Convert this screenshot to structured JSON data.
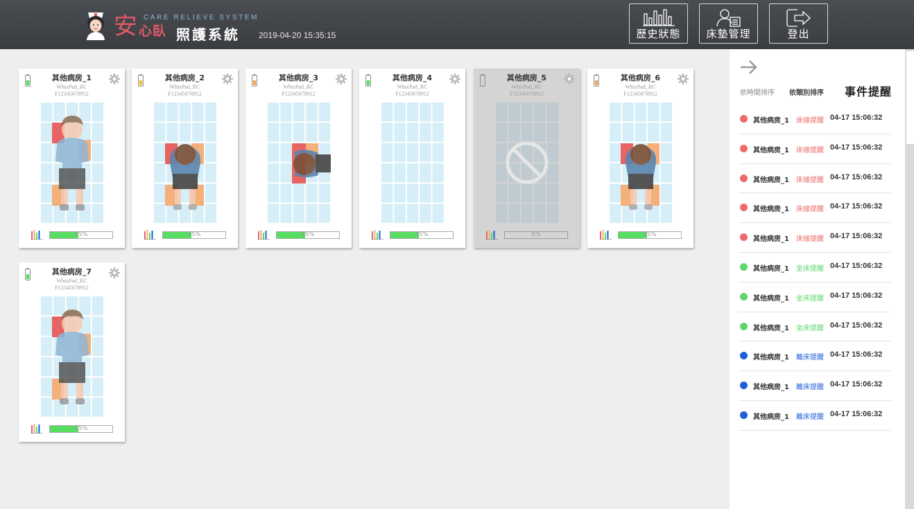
{
  "header": {
    "brand_an": "安",
    "brand_xinwo": "心臥",
    "brand_en": "Care Relieve System",
    "brand_zh": "照護系統",
    "datetime": "2019-04-20 15:35:15",
    "buttons": [
      {
        "label": "歷史狀態",
        "icon": "bar-chart-icon"
      },
      {
        "label": "床墊管理",
        "icon": "user-card-icon"
      },
      {
        "label": "登出",
        "icon": "logout-icon"
      }
    ]
  },
  "cards": [
    {
      "room": "其他病房_1",
      "device": "WhizPad_RC",
      "serial": "F12345678912",
      "progress_label": "45%",
      "progress": 0.45,
      "battery": "green",
      "status": "lying"
    },
    {
      "room": "其他病房_2",
      "device": "WhizPad_RC",
      "serial": "F12345678912",
      "progress_label": "45%",
      "progress": 0.45,
      "battery": "yellow",
      "status": "sitting"
    },
    {
      "room": "其他病房_3",
      "device": "WhizPad_RC",
      "serial": "F12345678912",
      "progress_label": "45%",
      "progress": 0.45,
      "battery": "orange",
      "status": "side-sitting"
    },
    {
      "room": "其他病房_4",
      "device": "WhizPad_RC",
      "serial": "F12345678912",
      "progress_label": "45%",
      "progress": 0.45,
      "battery": "green",
      "status": "empty"
    },
    {
      "room": "其他病房_5",
      "device": "WhizPad_RC",
      "serial": "F12345678912",
      "progress_label": "0%",
      "progress": 0,
      "battery": "empty",
      "status": "offline"
    },
    {
      "room": "其他病房_6",
      "device": "WhizPad_RC",
      "serial": "F12345678912",
      "progress_label": "45%",
      "progress": 0.45,
      "battery": "orange",
      "status": "sitting"
    },
    {
      "room": "其他病房_7",
      "device": "WhizPad_RC",
      "serial": "F12345678912",
      "progress_label": "45%",
      "progress": 0.45,
      "battery": "green",
      "status": "lying"
    }
  ],
  "panel": {
    "sort_time": "依時間排序",
    "sort_type": "依類別排序",
    "title": "事件提醒",
    "events": [
      {
        "room": "其他病房_1",
        "type": "床緣提醒",
        "time": "04-17 15:06:32",
        "color": "#ee6b6b"
      },
      {
        "room": "其他病房_1",
        "type": "床緣提醒",
        "time": "04-17 15:06:32",
        "color": "#ee6b6b"
      },
      {
        "room": "其他病房_1",
        "type": "床緣提醒",
        "time": "04-17 15:06:32",
        "color": "#ee6b6b"
      },
      {
        "room": "其他病房_1",
        "type": "床緣提醒",
        "time": "04-17 15:06:32",
        "color": "#ee6b6b"
      },
      {
        "room": "其他病房_1",
        "type": "床緣提醒",
        "time": "04-17 15:06:32",
        "color": "#ee6b6b"
      },
      {
        "room": "其他病房_1",
        "type": "坐床提醒",
        "time": "04-17 15:06:32",
        "color": "#5fd66d"
      },
      {
        "room": "其他病房_1",
        "type": "坐床提醒",
        "time": "04-17 15:06:32",
        "color": "#5fd66d"
      },
      {
        "room": "其他病房_1",
        "type": "坐床提醒",
        "time": "04-17 15:06:32",
        "color": "#5fd66d"
      },
      {
        "room": "其他病房_1",
        "type": "離床提醒",
        "time": "04-17 15:06:32",
        "color": "#1f5fd8"
      },
      {
        "room": "其他病房_1",
        "type": "離床提醒",
        "time": "04-17 15:06:32",
        "color": "#1f5fd8"
      },
      {
        "room": "其他病房_1",
        "type": "離床提醒",
        "time": "04-17 15:06:32",
        "color": "#1f5fd8"
      }
    ]
  },
  "colors": {
    "header_bg": "#3f4246",
    "accent_red": "#e05a66",
    "progress_green": "#58dd63",
    "grid_cell": "#d6eef7"
  }
}
